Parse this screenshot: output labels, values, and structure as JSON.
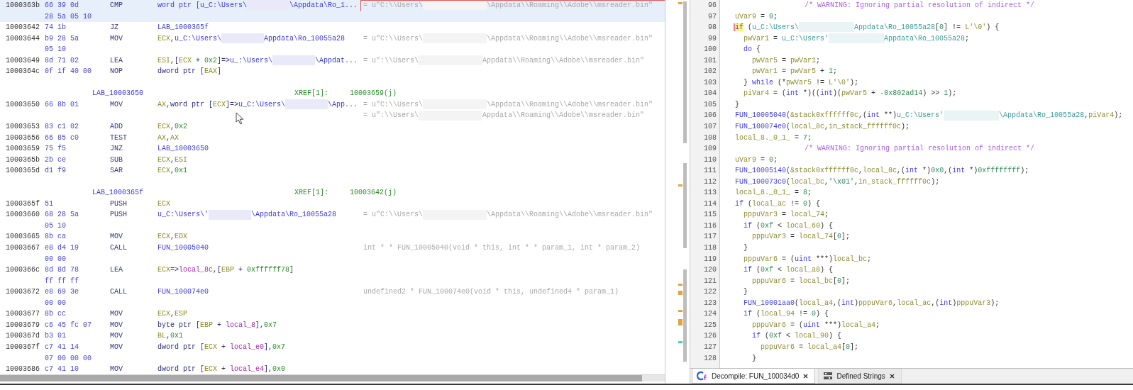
{
  "listing": {
    "rows": [
      {
        "kind": "insn",
        "selected": true,
        "framed": true,
        "address": "1000363b",
        "bytes": "66 39 0d",
        "mnemonic": "CMP",
        "operand": [
          {
            "kind": "ref",
            "text": "word ptr [u_C:\\Users\\"
          },
          {
            "kind": "redacted"
          },
          {
            "kind": "ref",
            "text": "\\Appdata\\Ro_1..."
          }
        ],
        "comment": [
          {
            "kind": "text",
            "text": "= u\"C:\\\\Users\\"
          },
          {
            "kind": "redacted"
          },
          {
            "kind": "text",
            "text": "\\Appdata\\\\Roaming\\\\Adobe\\\\msreader.bin\""
          }
        ]
      },
      {
        "kind": "cont",
        "selected": true,
        "bytes": "28 5a 05 10"
      },
      {
        "kind": "insn",
        "selected": false,
        "address": "10003642",
        "bytes": "74 1b",
        "mnemonic": "JZ",
        "operand": [
          {
            "kind": "ref",
            "text": "LAB_1000365f"
          }
        ]
      },
      {
        "kind": "insn",
        "selected": false,
        "address": "10003644",
        "bytes": "b9 28 5a",
        "mnemonic": "MOV",
        "operand": [
          {
            "kind": "reg",
            "text": "ECX"
          },
          {
            "kind": "text",
            "text": ","
          },
          {
            "kind": "ref",
            "text": "u_C:\\Users\\"
          },
          {
            "kind": "redacted"
          },
          {
            "kind": "ref",
            "text": "Appdata\\Ro_10055a28"
          }
        ],
        "comment": [
          {
            "kind": "text",
            "text": "= u\"C:\\\\Users\\"
          },
          {
            "kind": "redacted"
          },
          {
            "kind": "text",
            "text": "\\Appdata\\\\Roaming\\\\Adobe\\\\msreader.bin\""
          }
        ]
      },
      {
        "kind": "cont",
        "selected": false,
        "bytes": "05 10"
      },
      {
        "kind": "insn",
        "selected": false,
        "address": "10003649",
        "bytes": "8d 71 02",
        "mnemonic": "LEA",
        "operand": [
          {
            "kind": "reg",
            "text": "ESI"
          },
          {
            "kind": "text",
            "text": ",["
          },
          {
            "kind": "reg",
            "text": "ECX"
          },
          {
            "kind": "text",
            "text": " + "
          },
          {
            "kind": "num",
            "text": "0x2"
          },
          {
            "kind": "text",
            "text": "]=>"
          },
          {
            "kind": "ref",
            "text": "u_:\\Users\\"
          },
          {
            "kind": "redacted"
          },
          {
            "kind": "ref",
            "text": "\\Appdat..."
          }
        ],
        "comment": [
          {
            "kind": "text",
            "text": "= u\":\\\\Users\\"
          },
          {
            "kind": "redacted"
          },
          {
            "kind": "text",
            "text": "Appdata\\\\Roaming\\\\Adobe\\\\msreader.bin\""
          }
        ]
      },
      {
        "kind": "insn",
        "selected": false,
        "address": "1000364c",
        "bytes": "0f 1f 40 00",
        "mnemonic": "NOP",
        "operand": [
          {
            "kind": "text",
            "text": "dword ptr ["
          },
          {
            "kind": "reg",
            "text": "EAX"
          },
          {
            "kind": "text",
            "text": "]"
          }
        ]
      },
      {
        "kind": "blank",
        "selected": false
      },
      {
        "kind": "label",
        "selected": false,
        "label": "LAB_10003650",
        "xref": "XREF[1]:",
        "ref": "10003659(j)"
      },
      {
        "kind": "insn",
        "selected": false,
        "address": "10003650",
        "bytes": "66 8b 01",
        "mnemonic": "MOV",
        "operand": [
          {
            "kind": "reg",
            "text": "AX"
          },
          {
            "kind": "text",
            "text": ",word ptr ["
          },
          {
            "kind": "reg",
            "text": "ECX"
          },
          {
            "kind": "text",
            "text": "]=>"
          },
          {
            "kind": "ref",
            "text": "u_C:\\Users\\"
          },
          {
            "kind": "redacted"
          },
          {
            "kind": "ref",
            "text": "\\App..."
          }
        ],
        "comment": [
          {
            "kind": "text",
            "text": "= u\"C:\\\\Users\\"
          },
          {
            "kind": "redacted"
          },
          {
            "kind": "text",
            "text": "\\Appdata\\\\Roaming\\\\Adobe\\\\msreader.bin\""
          }
        ]
      },
      {
        "kind": "cont",
        "selected": false,
        "comment": [
          {
            "kind": "text",
            "text": "= u\":\\\\Users\\"
          },
          {
            "kind": "redacted"
          },
          {
            "kind": "text",
            "text": "Appdata\\\\Roaming\\\\Adobe\\\\msreader.bin\""
          }
        ]
      },
      {
        "kind": "insn",
        "selected": false,
        "address": "10003653",
        "bytes": "83 c1 02",
        "mnemonic": "ADD",
        "operand": [
          {
            "kind": "reg",
            "text": "ECX"
          },
          {
            "kind": "text",
            "text": ","
          },
          {
            "kind": "num",
            "text": "0x2"
          }
        ]
      },
      {
        "kind": "insn",
        "selected": false,
        "address": "10003656",
        "bytes": "66 85 c0",
        "mnemonic": "TEST",
        "operand": [
          {
            "kind": "reg",
            "text": "AX"
          },
          {
            "kind": "text",
            "text": ","
          },
          {
            "kind": "reg",
            "text": "AX"
          }
        ]
      },
      {
        "kind": "insn",
        "selected": false,
        "address": "10003659",
        "bytes": "75 f5",
        "mnemonic": "JNZ",
        "operand": [
          {
            "kind": "ref",
            "text": "LAB_10003650"
          }
        ]
      },
      {
        "kind": "insn",
        "selected": false,
        "address": "1000365b",
        "bytes": "2b ce",
        "mnemonic": "SUB",
        "operand": [
          {
            "kind": "reg",
            "text": "ECX"
          },
          {
            "kind": "text",
            "text": ","
          },
          {
            "kind": "reg",
            "text": "ESI"
          }
        ]
      },
      {
        "kind": "insn",
        "selected": false,
        "address": "1000365d",
        "bytes": "d1 f9",
        "mnemonic": "SAR",
        "operand": [
          {
            "kind": "reg",
            "text": "ECX"
          },
          {
            "kind": "text",
            "text": ","
          },
          {
            "kind": "num",
            "text": "0x1"
          }
        ]
      },
      {
        "kind": "blank",
        "selected": false
      },
      {
        "kind": "label",
        "selected": false,
        "label": "LAB_1000365f",
        "xref": "XREF[1]:",
        "ref": "10003642(j)"
      },
      {
        "kind": "insn",
        "selected": false,
        "address": "1000365f",
        "bytes": "51",
        "mnemonic": "PUSH",
        "operand": [
          {
            "kind": "reg",
            "text": "ECX"
          }
        ]
      },
      {
        "kind": "insn",
        "selected": false,
        "address": "10003660",
        "bytes": "68 28 5a",
        "mnemonic": "PUSH",
        "operand": [
          {
            "kind": "ref",
            "text": "u_C:\\Users\\'"
          },
          {
            "kind": "redacted"
          },
          {
            "kind": "ref",
            "text": "\\Appdata\\Ro_10055a28"
          }
        ],
        "comment": [
          {
            "kind": "text",
            "text": "= u\"C:\\\\Users\\"
          },
          {
            "kind": "redacted"
          },
          {
            "kind": "text",
            "text": "\\Appdata\\\\Roaming\\\\Adobe\\\\msreader.bin\""
          }
        ]
      },
      {
        "kind": "cont",
        "selected": false,
        "bytes": "05 10"
      },
      {
        "kind": "insn",
        "selected": false,
        "address": "10003665",
        "bytes": "8b ca",
        "mnemonic": "MOV",
        "operand": [
          {
            "kind": "reg",
            "text": "ECX"
          },
          {
            "kind": "text",
            "text": ","
          },
          {
            "kind": "reg",
            "text": "EDX"
          }
        ]
      },
      {
        "kind": "insn",
        "selected": false,
        "address": "10003667",
        "bytes": "e8 d4 19",
        "mnemonic": "CALL",
        "operand": [
          {
            "kind": "ref",
            "text": "FUN_10005040"
          }
        ],
        "comment": [
          {
            "kind": "text",
            "text": "int * * FUN_10005040(void * this, int * * param_1, int * param_2)"
          }
        ]
      },
      {
        "kind": "cont",
        "selected": false,
        "bytes": "00 00"
      },
      {
        "kind": "insn",
        "selected": false,
        "address": "1000366c",
        "bytes": "8d 8d 78",
        "mnemonic": "LEA",
        "operand": [
          {
            "kind": "reg",
            "text": "ECX"
          },
          {
            "kind": "text",
            "text": "=>"
          },
          {
            "kind": "var",
            "text": "local_8c"
          },
          {
            "kind": "text",
            "text": ",["
          },
          {
            "kind": "reg",
            "text": "EBP"
          },
          {
            "kind": "text",
            "text": " + "
          },
          {
            "kind": "num",
            "text": "0xffffff78"
          },
          {
            "kind": "text",
            "text": "]"
          }
        ]
      },
      {
        "kind": "cont",
        "selected": false,
        "bytes": "ff ff ff"
      },
      {
        "kind": "insn",
        "selected": false,
        "address": "10003672",
        "bytes": "e8 69 3e",
        "mnemonic": "CALL",
        "operand": [
          {
            "kind": "ref",
            "text": "FUN_100074e0"
          }
        ],
        "comment": [
          {
            "kind": "text",
            "text": "undefined2 * FUN_100074e0(void * this, undefined4 * param_1)"
          }
        ]
      },
      {
        "kind": "cont",
        "selected": false,
        "bytes": "00 00"
      },
      {
        "kind": "insn",
        "selected": false,
        "address": "10003677",
        "bytes": "8b cc",
        "mnemonic": "MOV",
        "operand": [
          {
            "kind": "reg",
            "text": "ECX"
          },
          {
            "kind": "text",
            "text": ","
          },
          {
            "kind": "reg",
            "text": "ESP"
          }
        ]
      },
      {
        "kind": "insn",
        "selected": false,
        "address": "10003679",
        "bytes": "c6 45 fc 07",
        "mnemonic": "MOV",
        "operand": [
          {
            "kind": "text",
            "text": "byte ptr ["
          },
          {
            "kind": "reg",
            "text": "EBP"
          },
          {
            "kind": "text",
            "text": " + "
          },
          {
            "kind": "var",
            "text": "local_8"
          },
          {
            "kind": "text",
            "text": "],"
          },
          {
            "kind": "num",
            "text": "0x7"
          }
        ]
      },
      {
        "kind": "insn",
        "selected": false,
        "address": "1000367d",
        "bytes": "b3 01",
        "mnemonic": "MOV",
        "operand": [
          {
            "kind": "reg",
            "text": "BL"
          },
          {
            "kind": "text",
            "text": ","
          },
          {
            "kind": "num",
            "text": "0x1"
          }
        ]
      },
      {
        "kind": "insn",
        "selected": false,
        "address": "1000367f",
        "bytes": "c7 41 14",
        "mnemonic": "MOV",
        "operand": [
          {
            "kind": "text",
            "text": "dword ptr ["
          },
          {
            "kind": "reg",
            "text": "ECX"
          },
          {
            "kind": "text",
            "text": " + "
          },
          {
            "kind": "var",
            "text": "local_e0"
          },
          {
            "kind": "text",
            "text": "],"
          },
          {
            "kind": "num",
            "text": "0x7"
          }
        ]
      },
      {
        "kind": "cont",
        "selected": false,
        "bytes": "07 00 00 00"
      },
      {
        "kind": "insn",
        "selected": false,
        "address": "10003686",
        "bytes": "c7 41 10",
        "mnemonic": "MOV",
        "operand": [
          {
            "kind": "text",
            "text": "dword ptr ["
          },
          {
            "kind": "reg",
            "text": "ECX"
          },
          {
            "kind": "text",
            "text": " + "
          },
          {
            "kind": "var",
            "text": "local_e4"
          },
          {
            "kind": "text",
            "text": "],"
          },
          {
            "kind": "num",
            "text": "0x0"
          }
        ]
      }
    ]
  },
  "decompiler": {
    "lines": [
      {
        "number": "96",
        "segments": [
          {
            "kind": "comment",
            "text": "/* WARNING: Ignoring partial resolution of indirect */"
          }
        ]
      },
      {
        "number": "97",
        "segments": [
          {
            "kind": "var",
            "text": "uVar9"
          },
          {
            "kind": "text",
            "text": " = "
          },
          {
            "kind": "num",
            "text": "0"
          },
          {
            "kind": "text",
            "text": ";"
          }
        ]
      },
      {
        "number": "98",
        "segments": [
          {
            "kind": "match",
            "text": "if"
          },
          {
            "kind": "text",
            "text": " ("
          },
          {
            "kind": "str",
            "text": "u_C:\\Users\\"
          },
          {
            "kind": "redacted"
          },
          {
            "kind": "str",
            "text": "Appdata\\Ro_10055a28"
          },
          {
            "kind": "text",
            "text": "["
          },
          {
            "kind": "num",
            "text": "0"
          },
          {
            "kind": "text",
            "text": "] != "
          },
          {
            "kind": "var",
            "text": "L'\\0'"
          },
          {
            "kind": "text",
            "text": ") {"
          }
        ],
        "children": [
          {
            "number": "99",
            "segments": [
              {
                "kind": "var",
                "text": "pwVar1"
              },
              {
                "kind": "text",
                "text": " = "
              },
              {
                "kind": "str",
                "text": "u_C:\\Users'"
              },
              {
                "kind": "redacted"
              },
              {
                "kind": "str",
                "text": "Appdata\\Ro_10055a28"
              },
              {
                "kind": "text",
                "text": ";"
              }
            ]
          },
          {
            "number": "100",
            "segments": [
              {
                "kind": "kw",
                "text": "do"
              },
              {
                "kind": "text",
                "text": " {"
              }
            ],
            "children": [
              {
                "number": "101",
                "segments": [
                  {
                    "kind": "var",
                    "text": "pwVar5"
                  },
                  {
                    "kind": "text",
                    "text": " = "
                  },
                  {
                    "kind": "var",
                    "text": "pwVar1"
                  },
                  {
                    "kind": "text",
                    "text": ";"
                  }
                ]
              },
              {
                "number": "102",
                "segments": [
                  {
                    "kind": "var",
                    "text": "pwVar1"
                  },
                  {
                    "kind": "text",
                    "text": " = "
                  },
                  {
                    "kind": "var",
                    "text": "pwVar5"
                  },
                  {
                    "kind": "text",
                    "text": " + "
                  },
                  {
                    "kind": "num",
                    "text": "1"
                  },
                  {
                    "kind": "text",
                    "text": ";"
                  }
                ]
              }
            ]
          },
          {
            "number": "103",
            "segments": [
              {
                "kind": "text",
                "text": "} "
              },
              {
                "kind": "kw",
                "text": "while"
              },
              {
                "kind": "text",
                "text": " (*"
              },
              {
                "kind": "var",
                "text": "pwVar5"
              },
              {
                "kind": "text",
                "text": " != "
              },
              {
                "kind": "var",
                "text": "L'\\0'"
              },
              {
                "kind": "text",
                "text": ");"
              }
            ]
          },
          {
            "number": "104",
            "segments": [
              {
                "kind": "var",
                "text": "piVar4"
              },
              {
                "kind": "text",
                "text": " = ("
              },
              {
                "kind": "kw",
                "text": "int"
              },
              {
                "kind": "text",
                "text": " *)(("
              },
              {
                "kind": "kw",
                "text": "int"
              },
              {
                "kind": "text",
                "text": ")("
              },
              {
                "kind": "var",
                "text": "pwVar5"
              },
              {
                "kind": "text",
                "text": " + "
              },
              {
                "kind": "num",
                "text": "-0x802ad14"
              },
              {
                "kind": "text",
                "text": ") >> "
              },
              {
                "kind": "num",
                "text": "1"
              },
              {
                "kind": "text",
                "text": ");"
              }
            ]
          }
        ]
      },
      {
        "number": "105",
        "segments": [
          {
            "kind": "text",
            "text": "}"
          }
        ]
      },
      {
        "number": "106",
        "segments": [
          {
            "kind": "func",
            "text": "FUN_10005040"
          },
          {
            "kind": "text",
            "text": "("
          },
          {
            "kind": "var",
            "text": "&stack0xffffff0c"
          },
          {
            "kind": "text",
            "text": ",("
          },
          {
            "kind": "kw",
            "text": "int"
          },
          {
            "kind": "text",
            "text": " **)"
          },
          {
            "kind": "str",
            "text": "u_C:\\Users'"
          },
          {
            "kind": "redacted"
          },
          {
            "kind": "str",
            "text": "\\Appdata\\Ro_10055a28"
          },
          {
            "kind": "text",
            "text": ","
          },
          {
            "kind": "var",
            "text": "piVar4"
          },
          {
            "kind": "text",
            "text": ");"
          }
        ]
      },
      {
        "number": "107",
        "segments": [
          {
            "kind": "func",
            "text": "FUN_100074e0"
          },
          {
            "kind": "text",
            "text": "("
          },
          {
            "kind": "var",
            "text": "local_8c"
          },
          {
            "kind": "text",
            "text": ","
          },
          {
            "kind": "var",
            "text": "in_stack_ffffff0c"
          },
          {
            "kind": "text",
            "text": ");"
          }
        ]
      },
      {
        "number": "108",
        "segments": [
          {
            "kind": "var",
            "text": "local_8._0_1_"
          },
          {
            "kind": "text",
            "text": " = "
          },
          {
            "kind": "num",
            "text": "7"
          },
          {
            "kind": "text",
            "text": ";"
          }
        ]
      },
      {
        "number": "109",
        "segments": [
          {
            "kind": "comment",
            "text": "/* WARNING: Ignoring partial resolution of indirect */"
          }
        ]
      },
      {
        "number": "110",
        "segments": [
          {
            "kind": "var",
            "text": "uVar9"
          },
          {
            "kind": "text",
            "text": " = "
          },
          {
            "kind": "num",
            "text": "0"
          },
          {
            "kind": "text",
            "text": ";"
          }
        ]
      },
      {
        "number": "111",
        "segments": [
          {
            "kind": "func",
            "text": "FUN_10005140"
          },
          {
            "kind": "text",
            "text": "("
          },
          {
            "kind": "var",
            "text": "&stack0xffffff0c"
          },
          {
            "kind": "text",
            "text": ","
          },
          {
            "kind": "var",
            "text": "local_8c"
          },
          {
            "kind": "text",
            "text": ",("
          },
          {
            "kind": "kw",
            "text": "int"
          },
          {
            "kind": "text",
            "text": " *)"
          },
          {
            "kind": "num",
            "text": "0x0"
          },
          {
            "kind": "text",
            "text": ",("
          },
          {
            "kind": "kw",
            "text": "int"
          },
          {
            "kind": "text",
            "text": " *)"
          },
          {
            "kind": "num",
            "text": "0xffffffff"
          },
          {
            "kind": "text",
            "text": ");"
          }
        ]
      },
      {
        "number": "112",
        "segments": [
          {
            "kind": "func",
            "text": "FUN_100073c0"
          },
          {
            "kind": "text",
            "text": "("
          },
          {
            "kind": "var",
            "text": "local_bc"
          },
          {
            "kind": "text",
            "text": ","
          },
          {
            "kind": "num",
            "text": "'\\x01'"
          },
          {
            "kind": "text",
            "text": ","
          },
          {
            "kind": "var",
            "text": "in_stack_ffffff0c"
          },
          {
            "kind": "text",
            "text": ");"
          }
        ]
      },
      {
        "number": "113",
        "segments": [
          {
            "kind": "var",
            "text": "local_8._0_1_"
          },
          {
            "kind": "text",
            "text": " = "
          },
          {
            "kind": "num",
            "text": "8"
          },
          {
            "kind": "text",
            "text": ";"
          }
        ]
      },
      {
        "number": "114",
        "segments": [
          {
            "kind": "kw",
            "text": "if"
          },
          {
            "kind": "text",
            "text": " ("
          },
          {
            "kind": "var",
            "text": "local_ac"
          },
          {
            "kind": "text",
            "text": " != "
          },
          {
            "kind": "num",
            "text": "0"
          },
          {
            "kind": "text",
            "text": ") {"
          }
        ],
        "children": [
          {
            "number": "115",
            "segments": [
              {
                "kind": "var",
                "text": "pppuVar3"
              },
              {
                "kind": "text",
                "text": " = "
              },
              {
                "kind": "var",
                "text": "local_74"
              },
              {
                "kind": "text",
                "text": ";"
              }
            ]
          },
          {
            "number": "116",
            "segments": [
              {
                "kind": "kw",
                "text": "if"
              },
              {
                "kind": "text",
                "text": " ("
              },
              {
                "kind": "num",
                "text": "0xf"
              },
              {
                "kind": "text",
                "text": " < "
              },
              {
                "kind": "var",
                "text": "local_60"
              },
              {
                "kind": "text",
                "text": ") {"
              }
            ],
            "children": [
              {
                "number": "117",
                "segments": [
                  {
                    "kind": "var",
                    "text": "pppuVar3"
                  },
                  {
                    "kind": "text",
                    "text": " = "
                  },
                  {
                    "kind": "var",
                    "text": "local_74"
                  },
                  {
                    "kind": "text",
                    "text": "["
                  },
                  {
                    "kind": "num",
                    "text": "0"
                  },
                  {
                    "kind": "text",
                    "text": "];"
                  }
                ]
              }
            ]
          },
          {
            "number": "118",
            "segments": [
              {
                "kind": "text",
                "text": "}"
              }
            ]
          },
          {
            "number": "119",
            "segments": [
              {
                "kind": "var",
                "text": "pppuVar6"
              },
              {
                "kind": "text",
                "text": " = ("
              },
              {
                "kind": "kw",
                "text": "uint"
              },
              {
                "kind": "text",
                "text": " ***)"
              },
              {
                "kind": "var",
                "text": "local_bc"
              },
              {
                "kind": "text",
                "text": ";"
              }
            ]
          },
          {
            "number": "120",
            "segments": [
              {
                "kind": "kw",
                "text": "if"
              },
              {
                "kind": "text",
                "text": " ("
              },
              {
                "kind": "num",
                "text": "0xf"
              },
              {
                "kind": "text",
                "text": " < "
              },
              {
                "kind": "var",
                "text": "local_a8"
              },
              {
                "kind": "text",
                "text": ") {"
              }
            ],
            "children": [
              {
                "number": "121",
                "segments": [
                  {
                    "kind": "var",
                    "text": "pppuVar6"
                  },
                  {
                    "kind": "text",
                    "text": " = "
                  },
                  {
                    "kind": "var",
                    "text": "local_bc"
                  },
                  {
                    "kind": "text",
                    "text": "["
                  },
                  {
                    "kind": "num",
                    "text": "0"
                  },
                  {
                    "kind": "text",
                    "text": "];"
                  }
                ]
              }
            ]
          },
          {
            "number": "122",
            "segments": [
              {
                "kind": "text",
                "text": "}"
              }
            ]
          },
          {
            "number": "123",
            "segments": [
              {
                "kind": "func",
                "text": "FUN_10001aa0"
              },
              {
                "kind": "text",
                "text": "("
              },
              {
                "kind": "var",
                "text": "local_a4"
              },
              {
                "kind": "text",
                "text": ",("
              },
              {
                "kind": "kw",
                "text": "int"
              },
              {
                "kind": "text",
                "text": ")"
              },
              {
                "kind": "var",
                "text": "pppuVar6"
              },
              {
                "kind": "text",
                "text": ","
              },
              {
                "kind": "var",
                "text": "local_ac"
              },
              {
                "kind": "text",
                "text": ",("
              },
              {
                "kind": "kw",
                "text": "int"
              },
              {
                "kind": "text",
                "text": ")"
              },
              {
                "kind": "var",
                "text": "pppuVar3"
              },
              {
                "kind": "text",
                "text": ");"
              }
            ]
          },
          {
            "number": "124",
            "segments": [
              {
                "kind": "kw",
                "text": "if"
              },
              {
                "kind": "text",
                "text": " ("
              },
              {
                "kind": "var",
                "text": "local_94"
              },
              {
                "kind": "text",
                "text": " != "
              },
              {
                "kind": "num",
                "text": "0"
              },
              {
                "kind": "text",
                "text": ") {"
              }
            ],
            "children": [
              {
                "number": "125",
                "segments": [
                  {
                    "kind": "var",
                    "text": "pppuVar6"
                  },
                  {
                    "kind": "text",
                    "text": " = ("
                  },
                  {
                    "kind": "kw",
                    "text": "uint"
                  },
                  {
                    "kind": "text",
                    "text": " ***)"
                  },
                  {
                    "kind": "var",
                    "text": "local_a4"
                  },
                  {
                    "kind": "text",
                    "text": ";"
                  }
                ]
              },
              {
                "number": "126",
                "segments": [
                  {
                    "kind": "kw",
                    "text": "if"
                  },
                  {
                    "kind": "text",
                    "text": " ("
                  },
                  {
                    "kind": "num",
                    "text": "0xf"
                  },
                  {
                    "kind": "text",
                    "text": " < "
                  },
                  {
                    "kind": "var",
                    "text": "local_90"
                  },
                  {
                    "kind": "text",
                    "text": ") {"
                  }
                ],
                "children": [
                  {
                    "number": "127",
                    "segments": [
                      {
                        "kind": "var",
                        "text": "pppuVar6"
                      },
                      {
                        "kind": "text",
                        "text": " = "
                      },
                      {
                        "kind": "var",
                        "text": "local_a4"
                      },
                      {
                        "kind": "text",
                        "text": "["
                      },
                      {
                        "kind": "num",
                        "text": "0"
                      },
                      {
                        "kind": "text",
                        "text": "];"
                      }
                    ]
                  }
                ]
              },
              {
                "number": "128",
                "segments": [
                  {
                    "kind": "text",
                    "text": "}"
                  }
                ]
              }
            ]
          }
        ]
      }
    ]
  },
  "tabs": [
    {
      "kind": "decompile",
      "label": "Decompile: FUN_100034d0",
      "selected": true
    },
    {
      "kind": "strings",
      "label": "Defined Strings",
      "selected": false
    }
  ]
}
